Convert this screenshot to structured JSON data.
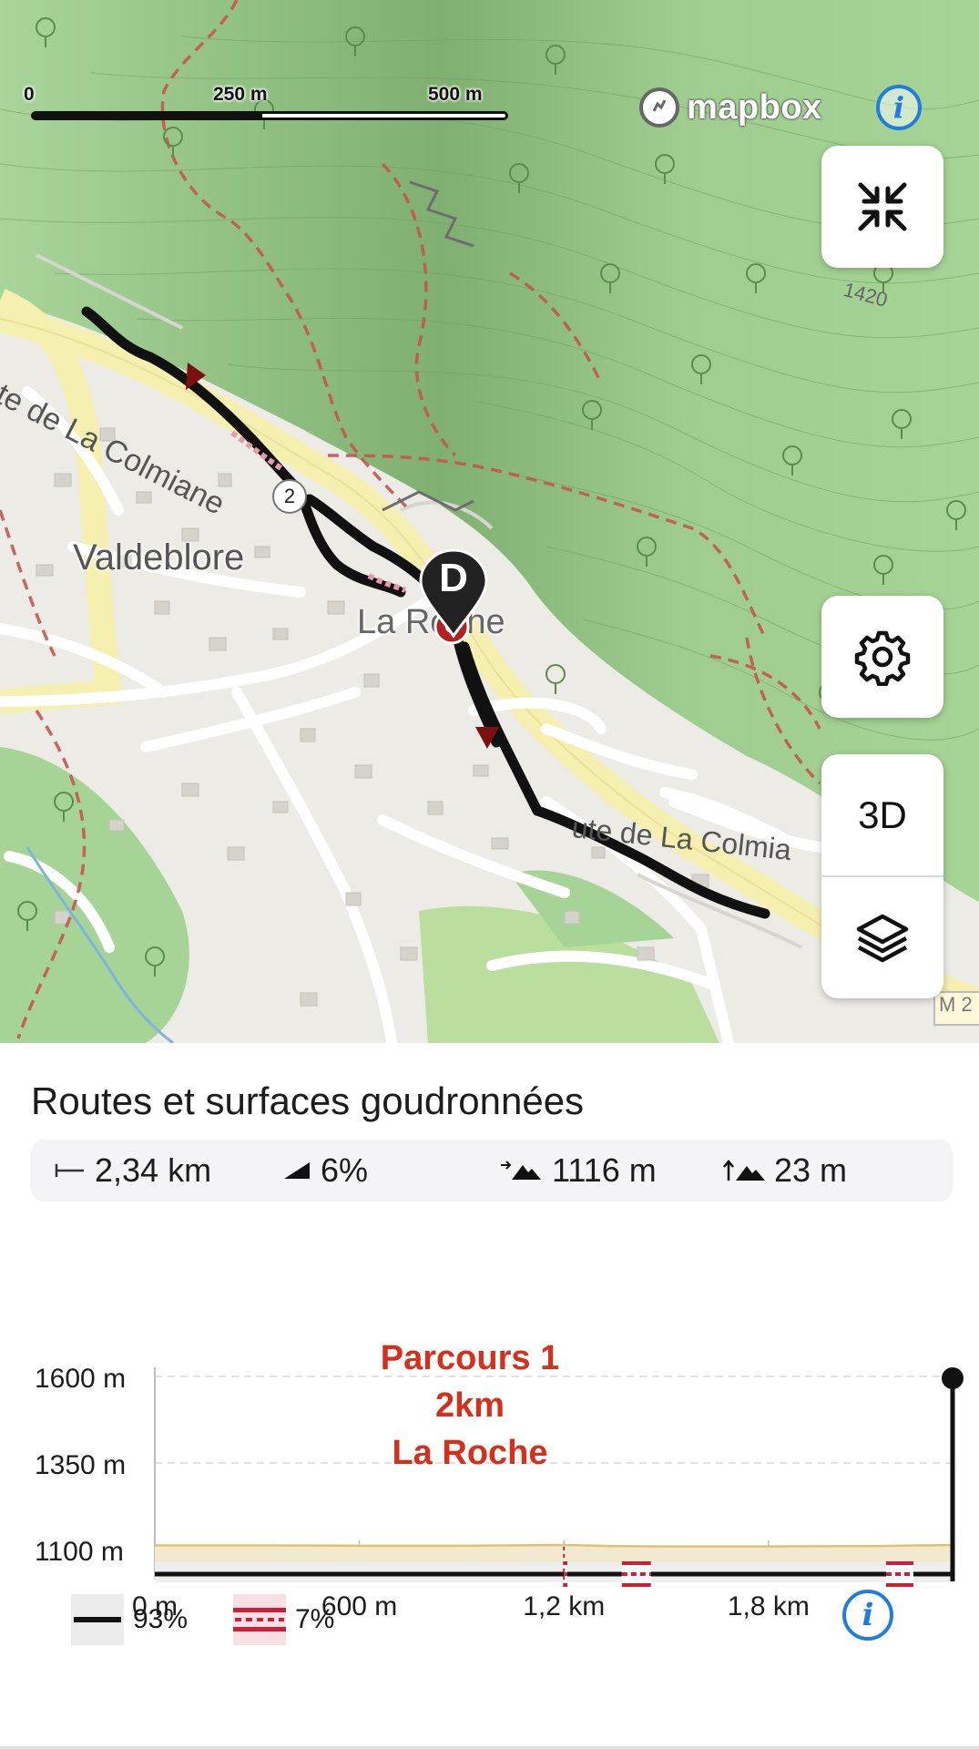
{
  "map": {
    "scale": {
      "ticks": [
        "0",
        "250 m",
        "500 m"
      ]
    },
    "attribution": {
      "brand": "mapbox"
    },
    "labels": {
      "road_upper": "ute de La Colmiane",
      "road_lower": "ute de La Colmia",
      "village": "Valdeblore",
      "hamlet": "La Roche",
      "elevation": "1420",
      "road_ref": "M 2"
    },
    "route_marker": "2",
    "pin_letter": "D",
    "buttons": {
      "collapse_icon": "collapse-arrows-icon",
      "settings_icon": "gear-icon",
      "mode_3d": "3D",
      "layers_icon": "layers-icon"
    },
    "colors": {
      "forest": "#9fce8f",
      "urban": "#ecebe6",
      "route": "#111111",
      "trail": "#c0504d",
      "accent": "#1f7ce0"
    }
  },
  "panel": {
    "title": "Routes et surfaces goudronnées",
    "stats": [
      {
        "icon": "distance-icon",
        "value": "2,34 km"
      },
      {
        "icon": "slope-icon",
        "value": "6%"
      },
      {
        "icon": "max-altitude-icon",
        "value": "1116 m"
      },
      {
        "icon": "elevation-gain-icon",
        "value": "23 m"
      }
    ],
    "annotation": [
      "Parcours 1",
      "2km",
      "La Roche"
    ],
    "legend": [
      {
        "icon": "road-surface-icon",
        "percent": "93%"
      },
      {
        "icon": "trail-surface-icon",
        "percent": "7%"
      }
    ]
  },
  "chart_data": {
    "type": "area",
    "ylabel_ticks": [
      "1600 m",
      "1350 m",
      "1100 m"
    ],
    "xlabel_ticks": [
      "0 m",
      "600 m",
      "1,2 km",
      "1,8 km"
    ],
    "ylim": [
      1100,
      1600
    ],
    "xlim": [
      0,
      2340
    ],
    "x": [
      0,
      300,
      600,
      900,
      1200,
      1350,
      1500,
      1800,
      2100,
      2340
    ],
    "y": [
      1112,
      1112,
      1111,
      1111,
      1113,
      1110,
      1109,
      1109,
      1110,
      1113
    ],
    "surface_segments": [
      {
        "type": "road",
        "from": 0,
        "to": 1200
      },
      {
        "type": "trail",
        "from": 1200,
        "to": 1210
      },
      {
        "type": "road",
        "from": 1210,
        "to": 1370
      },
      {
        "type": "trail",
        "from": 1370,
        "to": 1455
      },
      {
        "type": "road",
        "from": 1455,
        "to": 2145
      },
      {
        "type": "trail",
        "from": 2145,
        "to": 2225
      },
      {
        "type": "road",
        "from": 2225,
        "to": 2340
      }
    ],
    "grid": true
  }
}
